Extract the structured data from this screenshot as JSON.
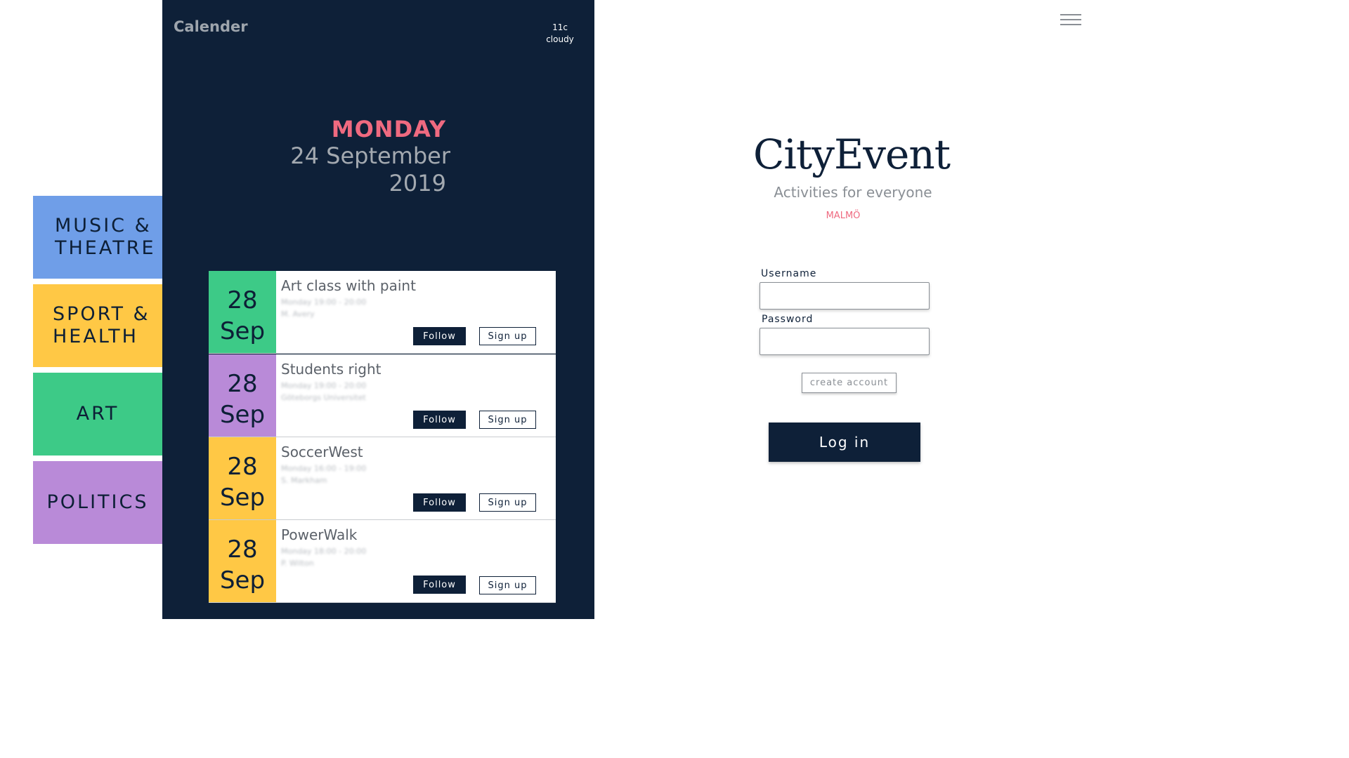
{
  "categories": [
    {
      "label": "MUSIC &\nTHEATRE",
      "color": "#6f9ee8"
    },
    {
      "label": "SPORT &\nHEALTH",
      "color": "#ffc845"
    },
    {
      "label": "ART",
      "color": "#3dca87"
    },
    {
      "label": "POLITICS",
      "color": "#b98ad8"
    }
  ],
  "calendar": {
    "title": "Calender",
    "weather": {
      "temp": "11c",
      "condition": "cloudy"
    },
    "day_name": "MONDAY",
    "date_line": "24 September",
    "year": "2019",
    "events": [
      {
        "day": "28",
        "month": "Sep",
        "title": "Art class with paint",
        "time": "Monday 19:00 - 20:00",
        "host": "M. Avery",
        "color": "#3dca87",
        "follow_label": "Follow",
        "signup_label": "Sign up"
      },
      {
        "day": "28",
        "month": "Sep",
        "title": "Students right",
        "time": "Monday 19:00 - 20:00",
        "host": "Göteborgs Universitet",
        "color": "#b98ad8",
        "follow_label": "Follow",
        "signup_label": "Sign up"
      },
      {
        "day": "28",
        "month": "Sep",
        "title": "SoccerWest",
        "time": "Monday 16:00 - 19:00",
        "host": "S. Markham",
        "color": "#ffc845",
        "follow_label": "Follow",
        "signup_label": "Sign up"
      },
      {
        "day": "28",
        "month": "Sep",
        "title": "PowerWalk",
        "time": "Monday 18:00 - 20:00",
        "host": "P. Wilton",
        "color": "#ffc845",
        "follow_label": "Follow",
        "signup_label": "Sign up"
      }
    ]
  },
  "login": {
    "brand": "CityEvent",
    "tagline": "Activities for everyone",
    "city": "MALMÖ",
    "username_label": "Username",
    "username_value": "",
    "password_label": "Password",
    "password_value": "",
    "create_account_label": "create account",
    "login_label": "Log in"
  },
  "colors": {
    "navy": "#0e2038",
    "pink": "#ef6a80"
  }
}
